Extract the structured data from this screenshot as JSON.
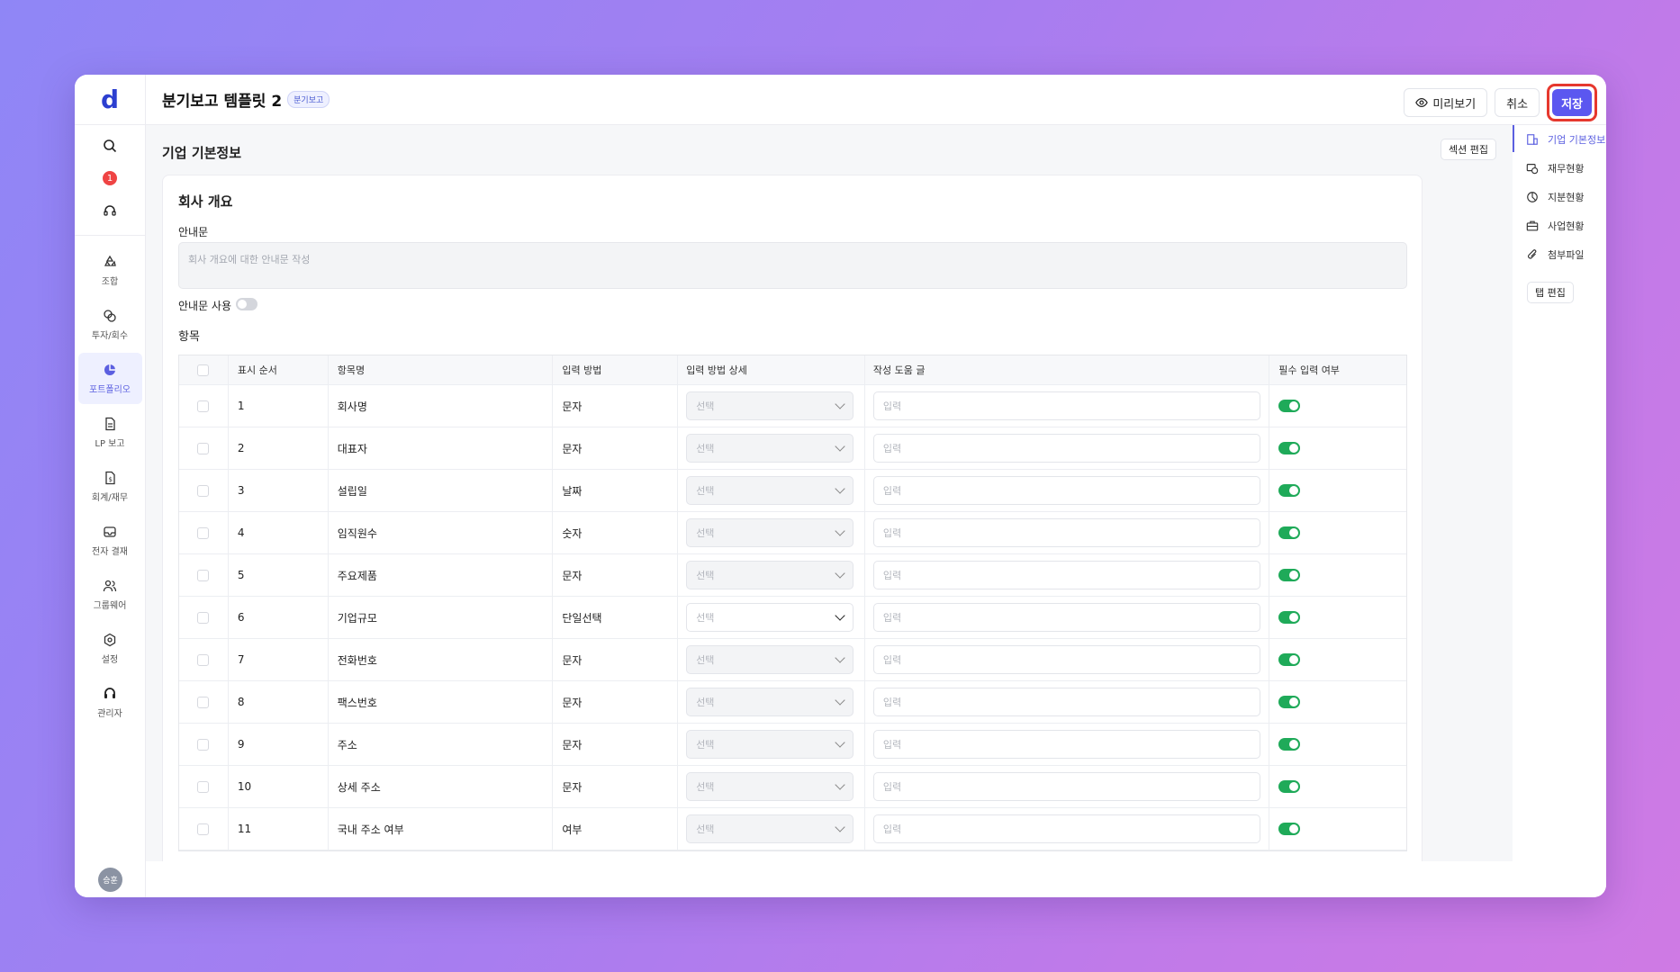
{
  "app": {
    "logo": "d",
    "avatar": "승훈",
    "notification_count": "1"
  },
  "nav": [
    {
      "label": "조합",
      "icon": "recycle-icon"
    },
    {
      "label": "투자/회수",
      "icon": "exchange-icon"
    },
    {
      "label": "포트폴리오",
      "icon": "pie-chart-icon",
      "active": true
    },
    {
      "label": "LP 보고",
      "icon": "document-icon"
    },
    {
      "label": "회계/재무",
      "icon": "ledger-icon"
    },
    {
      "label": "전자 결재",
      "icon": "inbox-icon"
    },
    {
      "label": "그룹웨어",
      "icon": "users-icon"
    },
    {
      "label": "설정",
      "icon": "gear-icon"
    },
    {
      "label": "관리자",
      "icon": "admin-icon"
    }
  ],
  "header": {
    "title": "분기보고 템플릿 2",
    "tag": "분기보고",
    "preview_label": "미리보기",
    "cancel_label": "취소",
    "save_label": "저장"
  },
  "section": {
    "title": "기업 기본정보",
    "edit_label": "섹션 편집"
  },
  "card": {
    "title": "회사 개요",
    "guide_label": "안내문",
    "guide_placeholder": "회사 개요에 대한 안내문 작성",
    "guide_toggle_label": "안내문 사용",
    "items_label": "항목"
  },
  "table": {
    "headers": [
      "표시 순서",
      "항목명",
      "입력 방법",
      "입력 방법 상세",
      "작성 도움 글",
      "필수 입력 여부"
    ],
    "select_placeholder": "선택",
    "input_placeholder": "입력",
    "rows": [
      {
        "order": "1",
        "name": "회사명",
        "method": "문자"
      },
      {
        "order": "2",
        "name": "대표자",
        "method": "문자"
      },
      {
        "order": "3",
        "name": "설립일",
        "method": "날짜"
      },
      {
        "order": "4",
        "name": "임직원수",
        "method": "숫자"
      },
      {
        "order": "5",
        "name": "주요제품",
        "method": "문자"
      },
      {
        "order": "6",
        "name": "기업규모",
        "method": "단일선택"
      },
      {
        "order": "7",
        "name": "전화번호",
        "method": "문자"
      },
      {
        "order": "8",
        "name": "팩스번호",
        "method": "문자"
      },
      {
        "order": "9",
        "name": "주소",
        "method": "문자"
      },
      {
        "order": "10",
        "name": "상세 주소",
        "method": "문자"
      },
      {
        "order": "11",
        "name": "국내 주소 여부",
        "method": "여부"
      }
    ]
  },
  "right_panel": {
    "items": [
      {
        "label": "기업 기본정보",
        "icon": "building-icon",
        "active": true
      },
      {
        "label": "재무현황",
        "icon": "coins-icon"
      },
      {
        "label": "지분현황",
        "icon": "pie-icon"
      },
      {
        "label": "사업현황",
        "icon": "briefcase-icon"
      },
      {
        "label": "첨부파일",
        "icon": "paperclip-icon"
      }
    ],
    "tab_edit_label": "탭 편집"
  },
  "colors": {
    "accent": "#5b57f0",
    "toggle_on": "#1faa59",
    "highlight_border": "#e6382e"
  }
}
